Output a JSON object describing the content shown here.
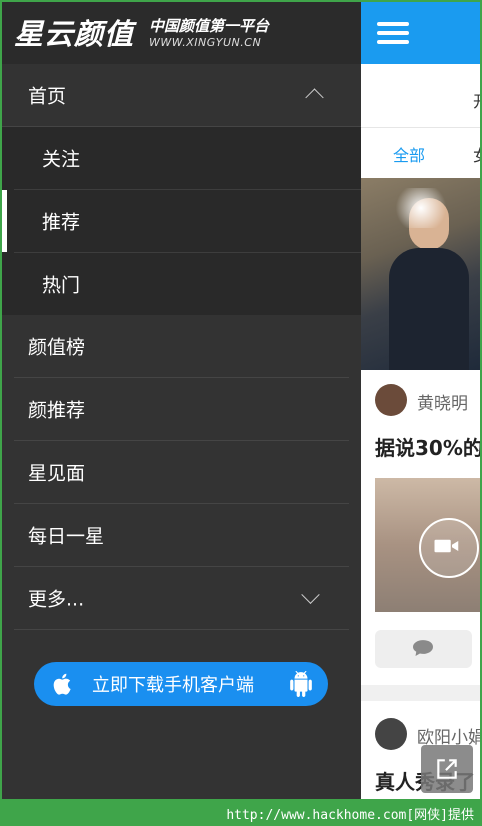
{
  "brand": {
    "logo_text": "星云颜值",
    "slogan": "中国颜值第一平台",
    "url": "WWW.XINGYUN.CN"
  },
  "menu": {
    "home": "首页",
    "sub_items": [
      "关注",
      "推荐",
      "热门"
    ],
    "active_sub": "推荐",
    "items": [
      "颜值榜",
      "颜推荐",
      "星见面",
      "每日一星"
    ],
    "more": "更多..."
  },
  "download_button": {
    "label": "立即下载手机客户端",
    "left_icon": "apple-icon",
    "right_icon": "android-icon"
  },
  "content": {
    "subnav_partial": "开",
    "tab_all": "全部",
    "tab_next_partial": "女",
    "post1": {
      "author": "黄晓明",
      "title": "据说30%的"
    },
    "post2": {
      "author": "欧阳小娟",
      "title": "真人秀录了"
    }
  },
  "colors": {
    "accent": "#1a9bf0",
    "drawer_bg": "#333333",
    "download_button": "#1a8ff0"
  },
  "watermark": "http://www.hackhome.com[网侠]提供"
}
